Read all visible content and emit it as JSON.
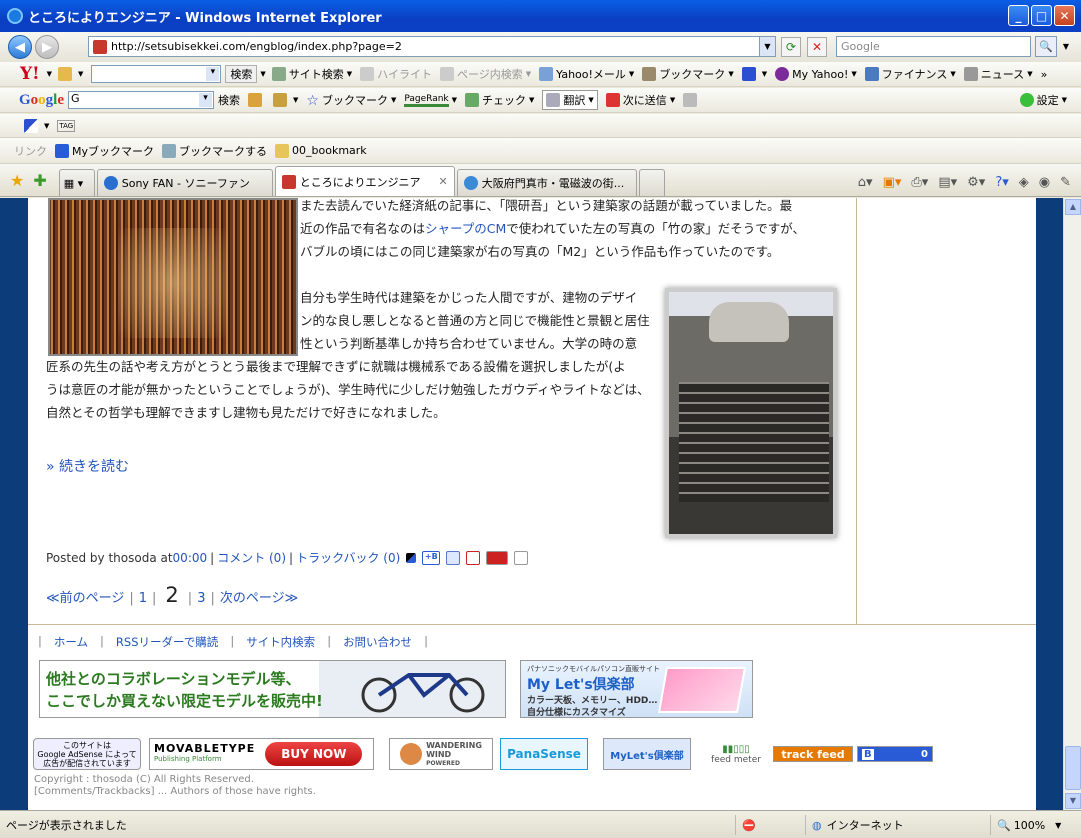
{
  "window": {
    "title": "ところによりエンジニア - Windows Internet Explorer",
    "min": "_",
    "max": "□",
    "close": "✕"
  },
  "address": {
    "url": "http://setsubisekkei.com/engblog/index.php?page=2",
    "search_placeholder": "Google"
  },
  "yahoo_toolbar": {
    "logo": "Y!",
    "search_btn": "検索",
    "site_search": "サイト検索",
    "highlight": "ハイライト",
    "page_search": "ページ内検索",
    "mail": "Yahoo!メール",
    "bookmark": "ブックマーク",
    "my_yahoo": "My Yahoo!",
    "finance": "ファイナンス",
    "news": "ニュース",
    "more": "»"
  },
  "google_toolbar": {
    "logo": "Google",
    "combo_value": "G",
    "search_btn": "検索",
    "bookmark": "ブックマーク",
    "pagerank": "PageRank",
    "check": "チェック",
    "translate": "翻訳",
    "send": "次に送信",
    "settings": "設定"
  },
  "misc_toolbar": {
    "tag": "TAG"
  },
  "links_bar": {
    "label": "リンク",
    "items": [
      "Myブックマーク",
      "ブックマークする",
      "00_bookmark"
    ]
  },
  "tabs": [
    {
      "label": "Sony FAN - ソニーファン",
      "active": false
    },
    {
      "label": "ところによりエンジニア",
      "active": true
    },
    {
      "label": "大阪府門真市・電磁波の街...",
      "active": false
    }
  ],
  "article": {
    "para1_line1": "また去読んでいた経済紙の記事に、「隈研吾」という建築家の話題が載っていました。最",
    "para1_line2_pre": "近の作品で有名なのは",
    "para1_link": "シャープのCM",
    "para1_line2_post": "で使われていた左の写真の「竹の家」だそうですが、",
    "para1_line3": "バブルの頃にはこの同じ建築家が右の写真の「M2」という作品も作っていたのです。",
    "para2_line1": "自分も学生時代は建築をかじった人間ですが、建物のデザイ",
    "para2_line2": "ン的な良し悪しとなると普通の方と同じで機能性と景観と居住",
    "para2_line3": "性という判断基準しか持ち合わせていません。大学の時の意",
    "para2_line4": "匠系の先生の話や考え方がとうとう最後まで理解できずに就職は機械系である設備を選択しましたが(よ",
    "para2_line5": "うは意匠の才能が無かったということでしょうが)、学生時代に少しだけ勉強したガウディやライトなどは、",
    "para2_line6": "自然とその哲学も理解できますし建物も見ただけで好きになれました。",
    "read_more": "» 続きを読む",
    "posted_by": "Posted by thosoda at ",
    "time": "00:00",
    "comments": "コメント (0)",
    "trackbacks": "トラックバック (0)",
    "hatena_badge": "+B"
  },
  "pager": {
    "prev": "≪前のページ",
    "p1": "1",
    "current": "2",
    "p3": "3",
    "next": "次のページ≫"
  },
  "footer_nav": [
    "ホーム",
    "RSSリーダーで購読",
    "サイト内検索",
    "お問い合わせ"
  ],
  "banners": {
    "collab_line1": "他社とのコラボレーションモデル等、",
    "collab_line2": "ここでしか買えない限定モデルを販売中!",
    "lets_small": "パナソニックモバイルパソコン直販サイト",
    "lets_brand": "My Let's倶楽部",
    "lets_sub1": "カラー天板、メモリー、HDD…",
    "lets_sub2": "自分仕様にカスタマイズ"
  },
  "badges": {
    "adsense_l1": "このサイトは",
    "adsense_l2": "Google AdSense によって",
    "adsense_l3": "広告が配信されています",
    "movabletype": "MOVABLETYPE",
    "mt_sub": "Publishing Platform",
    "buy_now": "BUY NOW",
    "wandering_l1": "WANDERING",
    "wandering_l2": "WIND",
    "wandering_l3": "POWERED",
    "panasense": "PanaSense",
    "mylets": "MyLet's倶楽部",
    "feedmeter": "feed meter",
    "trackfeed": "track feed",
    "hatena_b": "B",
    "hatena_count": "0"
  },
  "copyright": {
    "line1": "Copyright : thosoda (C) All Rights Reserved.",
    "line2": "[Comments/Trackbacks] ... Authors of those have rights."
  },
  "status": {
    "text": "ページが表示されました",
    "zone": "インターネット",
    "zoom": "100%"
  }
}
